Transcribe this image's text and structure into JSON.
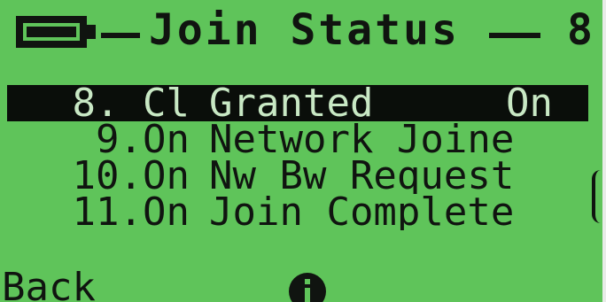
{
  "header": {
    "title": "Join Status",
    "page_number": "8",
    "battery_icon": "battery-icon"
  },
  "menu": {
    "items": [
      {
        "number": "8. Cl",
        "label": "Granted",
        "value": "On",
        "selected": true
      },
      {
        "number": "9.On",
        "label": "Network Joine",
        "value": "",
        "selected": false
      },
      {
        "number": "10.On",
        "label": "Nw Bw Request",
        "value": "",
        "selected": false
      },
      {
        "number": "11.On",
        "label": "Join Complete",
        "value": "",
        "selected": false
      }
    ]
  },
  "softkeys": {
    "left_label": "Back",
    "center_icon": "info-icon"
  },
  "colors": {
    "lcd_background": "#5fc45a",
    "text": "#101410",
    "highlight_background": "#0a0e0a",
    "highlight_text": "#c8e8c4"
  }
}
